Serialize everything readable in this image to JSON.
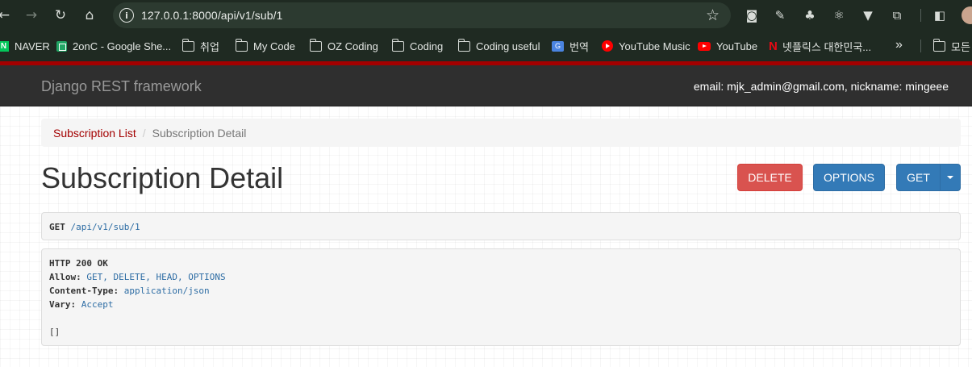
{
  "browser": {
    "url": "127.0.0.1:8000/api/v1/sub/1",
    "bookmarks": [
      {
        "label": "NAVER",
        "icon": "naver-icon"
      },
      {
        "label": "2onC - Google She...",
        "icon": "google-sheets-icon"
      },
      {
        "label": "취업",
        "icon": "folder-icon"
      },
      {
        "label": "My Code",
        "icon": "folder-icon"
      },
      {
        "label": "OZ Coding",
        "icon": "folder-icon"
      },
      {
        "label": "Coding",
        "icon": "folder-icon"
      },
      {
        "label": "Coding useful",
        "icon": "folder-icon"
      },
      {
        "label": "번역",
        "icon": "translate-icon"
      },
      {
        "label": "YouTube Music",
        "icon": "youtube-music-icon"
      },
      {
        "label": "YouTube",
        "icon": "youtube-icon"
      },
      {
        "label": "넷플릭스 대한민국...",
        "icon": "netflix-icon"
      }
    ],
    "more": "»",
    "other_bookmarks": "모든"
  },
  "navbar": {
    "brand": "Django REST framework",
    "user": "email: mjk_admin@gmail.com, nickname: mingeee"
  },
  "breadcrumb": {
    "link": "Subscription List",
    "separator": "/",
    "active": "Subscription Detail"
  },
  "page": {
    "title": "Subscription Detail",
    "buttons": {
      "delete": "DELETE",
      "options": "OPTIONS",
      "get": "GET"
    }
  },
  "request": {
    "method": "GET",
    "path": "/api/v1/sub/1"
  },
  "response": {
    "status": "HTTP 200 OK",
    "headers": [
      {
        "key": "Allow:",
        "value": "GET, DELETE, HEAD, OPTIONS"
      },
      {
        "key": "Content-Type:",
        "value": "application/json"
      },
      {
        "key": "Vary:",
        "value": "Accept"
      }
    ],
    "body": "[]"
  },
  "colors": {
    "accent_red": "#a30000",
    "navbar_bg": "#2f2f2f",
    "danger": "#d9534f",
    "primary": "#337ab7"
  }
}
